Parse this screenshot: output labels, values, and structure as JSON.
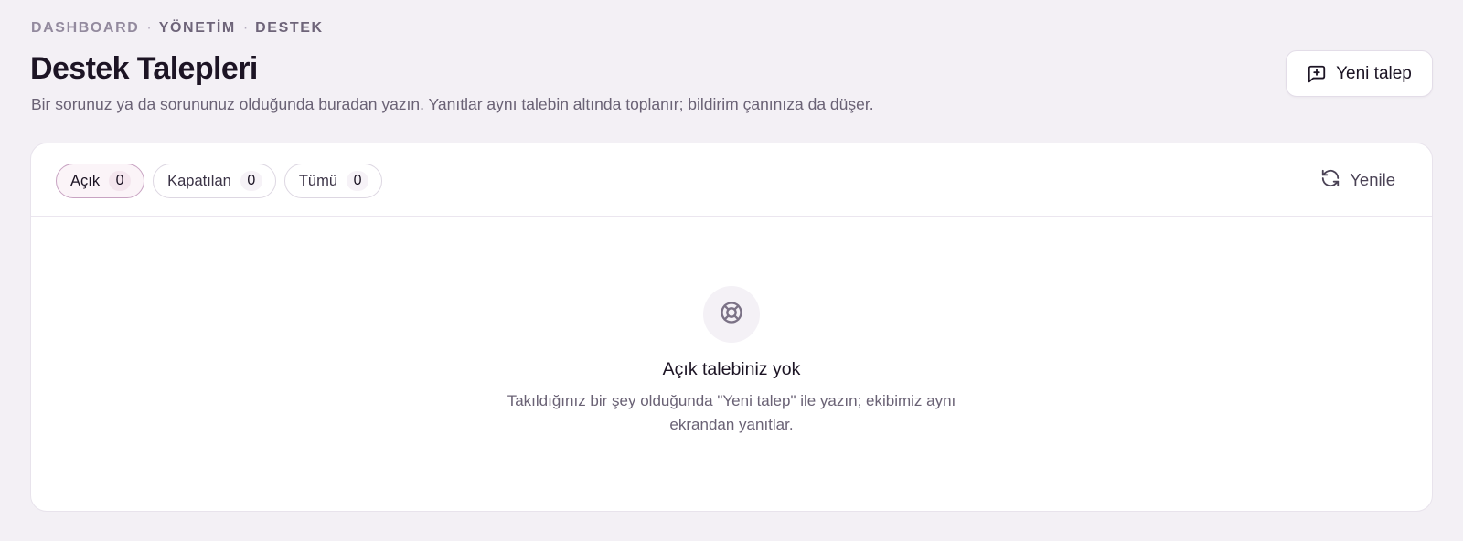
{
  "breadcrumb": {
    "items": [
      "DASHBOARD",
      "YÖNETİM",
      "DESTEK"
    ],
    "separator": "·"
  },
  "header": {
    "title": "Destek Talepleri",
    "subtitle": "Bir sorunuz ya da sorununuz olduğunda buradan yazın. Yanıtlar aynı talebin altında toplanır; bildirim çanınıza da düşer.",
    "new_ticket_label": "Yeni talep",
    "new_ticket_icon": "message-plus-icon"
  },
  "tabs": [
    {
      "label": "Açık",
      "count": "0",
      "active": true
    },
    {
      "label": "Kapatılan",
      "count": "0",
      "active": false
    },
    {
      "label": "Tümü",
      "count": "0",
      "active": false
    }
  ],
  "toolbar": {
    "refresh_label": "Yenile",
    "refresh_icon": "refresh-icon"
  },
  "empty_state": {
    "icon": "lifebuoy-icon",
    "title": "Açık talebiniz yok",
    "description": "Takıldığınız bir şey olduğunda \"Yeni talep\" ile yazın; ekibimiz aynı ekrandan yanıtlar."
  },
  "colors": {
    "background": "#f3f0f5",
    "accent_border": "#c8a3c2",
    "accent_bg": "#fbf4f8",
    "text_primary": "#1c1424",
    "text_muted": "#6a6275"
  }
}
